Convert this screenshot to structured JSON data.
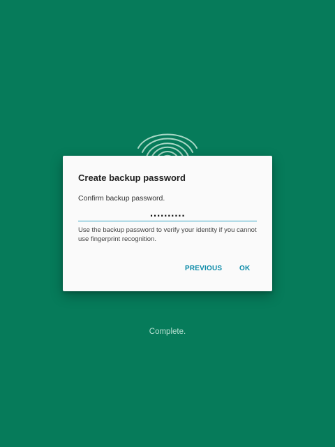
{
  "dialog": {
    "title": "Create backup password",
    "prompt": "Confirm backup password.",
    "password_value": "..........",
    "help_text": "Use the backup password to verify your identity if you cannot use fingerprint recognition.",
    "previous_label": "PREVIOUS",
    "ok_label": "OK"
  },
  "status": {
    "text": "Complete."
  },
  "background": {
    "icon": "fingerprint-icon"
  },
  "colors": {
    "background": "#067b5a",
    "dialog": "#fafafa",
    "accent": "#0a8aa8",
    "input_underline": "#35a6c6",
    "status_text": "#b7e0d2"
  }
}
